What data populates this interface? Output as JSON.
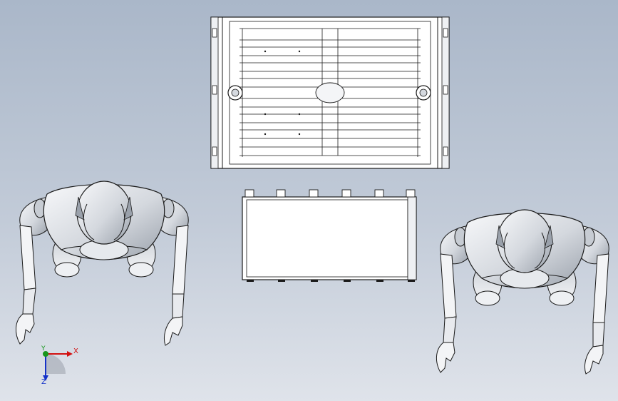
{
  "viewport": {
    "background_top": "#aab7c9",
    "background_bottom": "#dfe3ea",
    "model_fill": "#ffffff",
    "robot_shade": "#d7dbe0",
    "edge_color": "#1a1a1a"
  },
  "triad": {
    "x_label": "X",
    "y_label": "Y",
    "z_label": "Z",
    "x_color": "#d21010",
    "y_color": "#17961c",
    "z_color": "#1532c8"
  },
  "icons": [
    "coordinate-triad-icon"
  ]
}
